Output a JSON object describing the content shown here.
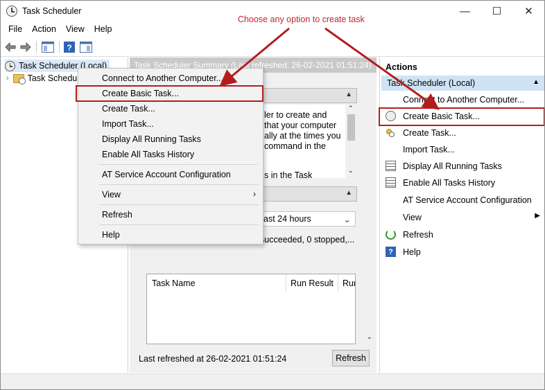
{
  "window": {
    "title": "Task Scheduler",
    "controls": {
      "minimize": "—",
      "maximize": "☐",
      "close": "✕"
    }
  },
  "menu": [
    "File",
    "Action",
    "View",
    "Help"
  ],
  "tree": {
    "root": "Task Scheduler (Local)",
    "child": "Task Schedu"
  },
  "center": {
    "header": "Task Scheduler Summary (Last refreshed: 26-02-2021 01:51:24)",
    "overview_lines": [
      "ler to create and",
      "that your computer",
      "ally at the times you",
      "command in the",
      "s in the Task"
    ],
    "period": "ast 24 hours",
    "status_summary": "succeeded, 0 stopped,...",
    "grid_headers": [
      "Task Name",
      "Run Result",
      "Rur"
    ],
    "last_refreshed": "Last refreshed at 26-02-2021 01:51:24",
    "refresh_button": "Refresh"
  },
  "context_menu": {
    "items": [
      "Connect to Another Computer...",
      "Create Basic Task...",
      "Create Task...",
      "Import Task...",
      "Display All Running Tasks",
      "Enable All Tasks History",
      "AT Service Account Configuration",
      "View",
      "Refresh",
      "Help"
    ]
  },
  "actions": {
    "title": "Actions",
    "subheader": "Task Scheduler (Local)",
    "items": [
      {
        "label": "Connect to Another Computer...",
        "icon": "none"
      },
      {
        "label": "Create Basic Task...",
        "icon": "create-basic-task-icon"
      },
      {
        "label": "Create Task...",
        "icon": "create-task-icon"
      },
      {
        "label": "Import Task...",
        "icon": "none"
      },
      {
        "label": "Display All Running Tasks",
        "icon": "running-tasks-icon"
      },
      {
        "label": "Enable All Tasks History",
        "icon": "history-icon"
      },
      {
        "label": "AT Service Account Configuration",
        "icon": "none"
      },
      {
        "label": "View",
        "icon": "none"
      },
      {
        "label": "Refresh",
        "icon": "refresh-icon"
      },
      {
        "label": "Help",
        "icon": "help-icon"
      }
    ]
  },
  "annotation": {
    "text": "Choose any option to create task",
    "color": "#c0262d"
  },
  "colors": {
    "highlight_border": "#b31d1d",
    "actions_subheader_bg": "#cfe3f5"
  }
}
